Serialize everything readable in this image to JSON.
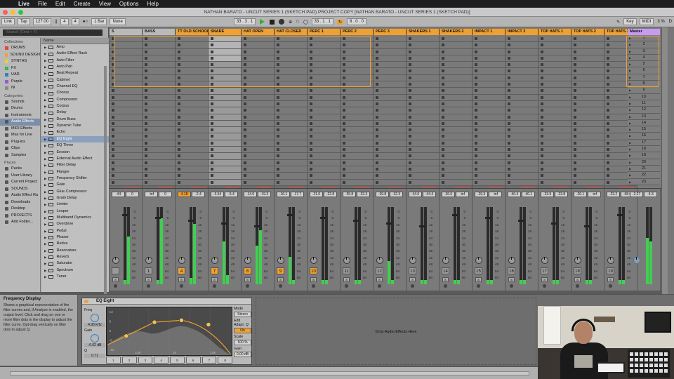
{
  "menubar": {
    "items": [
      "Live",
      "File",
      "Edit",
      "Create",
      "View",
      "Options",
      "Help"
    ]
  },
  "window": {
    "title": "NATHAN BARATO - UNCUT SERIES 1 (SKETCH PAD) PROJECT COPY  [NATHAN BARATO - UNCUT SERIES 1 (SKETCH PAD)]"
  },
  "transport": {
    "link": "Link",
    "tap": "Tap",
    "tempo": "127.00",
    "sig_num": "4",
    "sig_den": "4",
    "metro": "1 Bar",
    "quant": "None",
    "position": "33 .  3 .  1",
    "loop_start": "33 .  1 .  1",
    "loop_len": "8 .  0 .  0",
    "key": "Key",
    "midi": "MIDI",
    "cpu": "3 %",
    "disk": "D"
  },
  "browser": {
    "search_placeholder": "Search (Cmd + F)",
    "collections_label": "Collections",
    "collections": [
      {
        "label": "DRUMS",
        "color": "#e2473b"
      },
      {
        "label": "SOUND DESIGN",
        "color": "#f0a030"
      },
      {
        "label": "SYNTHS",
        "color": "#e6d23a"
      },
      {
        "label": "FX",
        "color": "#3fb04f"
      },
      {
        "label": "UAD",
        "color": "#2f80c8"
      },
      {
        "label": "Purple",
        "color": "#9a5cc8"
      },
      {
        "label": "NI",
        "color": "#8a8a8a"
      }
    ],
    "categories_label": "Categories",
    "categories": [
      "Sounds",
      "Drums",
      "Instruments",
      "Audio Effects",
      "MIDI Effects",
      "Max for Live",
      "Plug-ins",
      "Clips",
      "Samples"
    ],
    "places_label": "Places",
    "places": [
      "Packs",
      "User Library",
      "Current Project",
      "SOUNDS",
      "Audio Effect Ra",
      "Downloads",
      "Desktop",
      "PROJECTS",
      "Add Folder..."
    ],
    "name_header": "Name",
    "items": [
      "Amp",
      "Audio Effect Rack",
      "Auto Filter",
      "Auto Pan",
      "Beat Repeat",
      "Cabinet",
      "Channel EQ",
      "Chorus",
      "Compressor",
      "Corpus",
      "Delay",
      "Drum Buss",
      "Dynamic Tube",
      "Echo",
      "EQ Eight",
      "EQ Three",
      "Erosion",
      "External Audio Effect",
      "Filter Delay",
      "Flanger",
      "Frequency Shifter",
      "Gate",
      "Glue Compressor",
      "Grain Delay",
      "Limiter",
      "Looper",
      "Multiband Dynamics",
      "Overdrive",
      "Pedal",
      "Phaser",
      "Redux",
      "Resonators",
      "Reverb",
      "Saturator",
      "Spectrum",
      "Tuner"
    ]
  },
  "tracks": [
    {
      "name": "S",
      "color": "#b9b9b9",
      "vol": "-44",
      "pk": "0",
      "num": ""
    },
    {
      "name": "BASS",
      "color": "#b9b9b9",
      "vol": "-inf",
      "pk": "0",
      "num": "1"
    },
    {
      "name": "TT OLD SCHOOL",
      "color": "#f0a030",
      "vol": "4.18",
      "pk": "-2.4",
      "num": "4"
    },
    {
      "name": "SNARE",
      "color": "#f0a030",
      "vol": "-3.54",
      "pk": "-5.4",
      "num": "7"
    },
    {
      "name": "HAT OPEN",
      "color": "#f0a030",
      "vol": "-14.0",
      "pk": "-19.3",
      "num": "8"
    },
    {
      "name": "HAT CLOSED",
      "color": "#f0a030",
      "vol": "-16.1",
      "pk": "-17.7",
      "num": "9"
    },
    {
      "name": "PERC 1",
      "color": "#f0a030",
      "vol": "-21.0",
      "pk": "-22.8",
      "num": "10"
    },
    {
      "name": "PERC 2",
      "color": "#f0a030",
      "vol": "-35.8",
      "pk": "-32.3",
      "num": "11"
    },
    {
      "name": "PERC 3",
      "color": "#f0a030",
      "vol": "-39.8",
      "pk": "-32.3",
      "num": "12"
    },
    {
      "name": "SHAKERS 1",
      "color": "#f0a030",
      "vol": "-44.6",
      "pk": "-44.4",
      "num": "13"
    },
    {
      "name": "SHAKERS 2",
      "color": "#f0a030",
      "vol": "-26.6",
      "pk": "-inf",
      "num": "14"
    },
    {
      "name": "IMPACT 1",
      "color": "#f0a030",
      "vol": "-29.3",
      "pk": "-inf",
      "num": "15"
    },
    {
      "name": "IMPACT 2",
      "color": "#f0a030",
      "vol": "-40.4",
      "pk": "-40.1",
      "num": "16"
    },
    {
      "name": "TOP HATS 1",
      "color": "#f0a030",
      "vol": "-23.9",
      "pk": "-23.8",
      "num": "17"
    },
    {
      "name": "TOP HATS 2",
      "color": "#f0a030",
      "vol": "-26.1",
      "pk": "-inf",
      "num": "18"
    },
    {
      "name": "TOP HATS 3",
      "color": "#f0a030",
      "vol": "-23.2",
      "pk": "-68.0",
      "num": "19"
    },
    {
      "name": "",
      "color": "#f0a030",
      "vol": "-37.0",
      "pk": "-37.3",
      "num": "20"
    }
  ],
  "master": {
    "name": "Master",
    "vol": "-2.27",
    "pk": "-4.3"
  },
  "scenes": [
    "1",
    "2",
    "3",
    "4",
    "5",
    "6",
    "7",
    "8",
    "9",
    "10",
    "11",
    "12",
    "13",
    "14",
    "15",
    "16",
    "17",
    "18",
    "19",
    "20",
    "21",
    "22",
    "23"
  ],
  "meter_scale": [
    "0",
    "6",
    "12",
    "18",
    "24",
    "30",
    "36",
    "42",
    "48",
    "54",
    "60"
  ],
  "meter_levels": [
    0.05,
    0.62,
    0.05,
    0.85,
    0.08,
    0.78,
    0.55,
    0.12,
    0.5,
    0.7,
    0.35,
    0.05,
    0.05,
    0.05,
    0.05,
    0.05,
    0.3,
    0.05,
    0.05,
    0.05,
    0.05,
    0.05,
    0.05,
    0.05,
    0.05,
    0.05,
    0.05,
    0.05,
    0.05,
    0.05,
    0.05,
    0.05,
    0.05,
    0.05
  ],
  "master_levels": [
    0.6,
    0.55
  ],
  "solo_label": "S",
  "info": {
    "title": "Frequency Display",
    "text": "Shows a graphical representation of the filter curves and, if Analyze is enabled, the output level. Click and drag on one or more filter dots in the display to adjust the filter curve. Opt-drag vertically on filter dots to adjust Q."
  },
  "eq": {
    "title": "EQ Eight",
    "freq_label": "Freq",
    "freq_value": "4.95 kHz",
    "gain_label": "Gain",
    "gain_value": "-0.62 dB",
    "q_label": "Q",
    "q_value": "0.71",
    "mode_label": "Mode",
    "mode_value": "Stereo",
    "edit_label": "Edit",
    "adapt_label": "Adapt. Q",
    "adapt_value": "On",
    "scale_label": "Scale",
    "scale_value": "100 %",
    "outgain_label": "Gain",
    "outgain_value": "0.00 dB",
    "axis": [
      "100",
      "1k",
      "10k"
    ],
    "db_axis": [
      "12",
      "6",
      "0",
      "-6",
      "-12"
    ],
    "bands": [
      "1",
      "2",
      "3",
      "4",
      "5",
      "6",
      "7",
      "8"
    ],
    "points": [
      [
        0.15,
        0.6
      ],
      [
        0.38,
        0.31
      ],
      [
        0.6,
        0.27
      ],
      [
        0.82,
        0.36
      ]
    ]
  },
  "drop_text": "Drop Audio Effects Here"
}
